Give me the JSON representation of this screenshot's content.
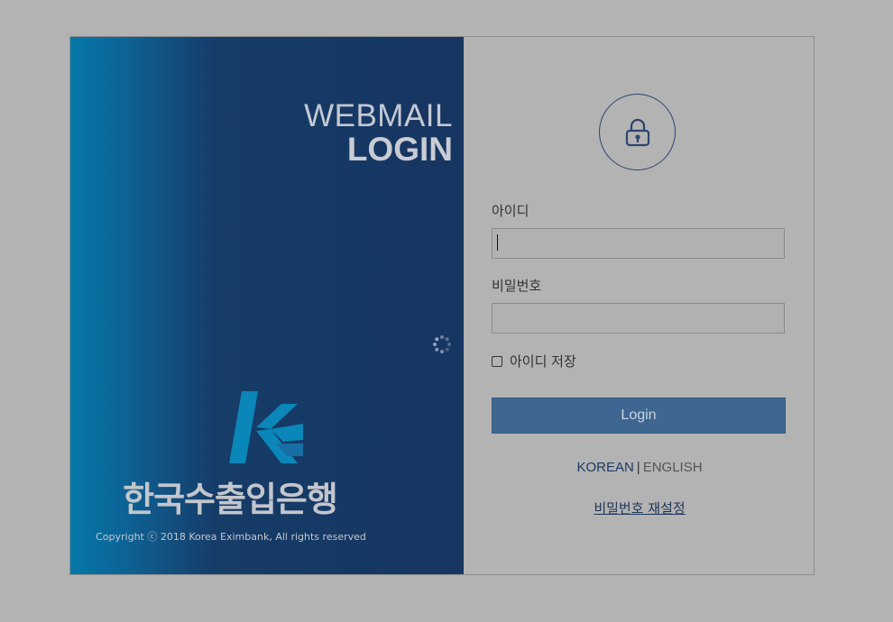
{
  "banner": {
    "title_line1": "WEBMAIL",
    "title_line2": "LOGIN",
    "bank_name": "한국수출입은행",
    "copyright": "Copyright ⓒ 2018 Korea Eximbank, All rights reserved"
  },
  "form": {
    "id_label": "아이디",
    "id_value": "",
    "password_label": "비밀번호",
    "password_value": "",
    "remember_label": "아이디 저장",
    "remember_checked": false,
    "login_label": "Login"
  },
  "language": {
    "korean": "KOREAN",
    "separator": "|",
    "english": "ENGLISH"
  },
  "reset_password_label": "비밀번호 재설정",
  "icons": {
    "lock": "lock-icon",
    "spinner": "loading-spinner-icon",
    "logo": "eximbank-logo"
  },
  "colors": {
    "overlay": "#b3b3b3",
    "banner_dark": "#173561",
    "banner_light": "#0478a8",
    "login_button": "#3d6791"
  }
}
